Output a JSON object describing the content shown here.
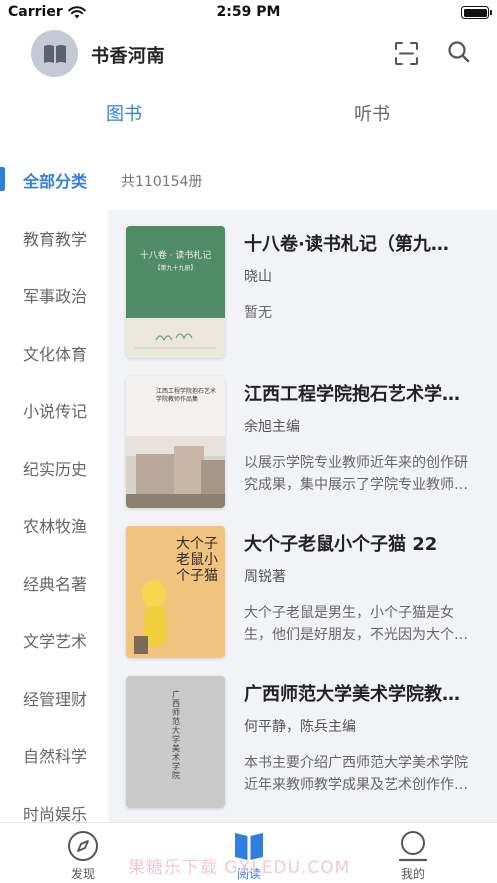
{
  "status_bar": {
    "carrier": "Carrier",
    "time": "2:59 PM"
  },
  "header": {
    "title": "书香河南"
  },
  "tabs": [
    {
      "label": "图书"
    },
    {
      "label": "听书"
    }
  ],
  "sidebar": {
    "items": [
      {
        "label": "全部分类"
      },
      {
        "label": "教育教学"
      },
      {
        "label": "军事政治"
      },
      {
        "label": "文化体育"
      },
      {
        "label": "小说传记"
      },
      {
        "label": "纪实历史"
      },
      {
        "label": "农林牧渔"
      },
      {
        "label": "经典名著"
      },
      {
        "label": "文学艺术"
      },
      {
        "label": "经管理财"
      },
      {
        "label": "自然科学"
      },
      {
        "label": "时尚娱乐"
      }
    ]
  },
  "list": {
    "count": "共110154册",
    "books": [
      {
        "title": "十八卷·读书札记（第九…",
        "author": "晓山",
        "desc": "暂无"
      },
      {
        "title": "江西工程学院抱石艺术学…",
        "author": "余旭主编",
        "desc": "以展示学院专业教师近年来的创作研究成果，集中展示了学院专业教师…"
      },
      {
        "title": "大个子老鼠小个子猫 22",
        "author": "周锐著",
        "desc": "大个子老鼠是男生，小个子猫是女生，他们是好朋友，不光因为大个…"
      },
      {
        "title": "广西师范大学美术学院教…",
        "author": "何平静，陈兵主编",
        "desc": "本书主要介绍广西师范大学美术学院近年来教师教学成果及艺术创作作…"
      }
    ],
    "covers": [
      {
        "text": "十八卷 · 读书札记",
        "sub": "【第九十九册】",
        "bg": "#4f8b64"
      },
      {
        "text": "江西工程学院抱石艺术学院教师作品集",
        "bg": "#efe9e0"
      },
      {
        "text": "大个子老鼠小个子猫",
        "bg": "#f2c37c"
      },
      {
        "text": "广西师范大学美术学院",
        "bg": "#c9c9c9"
      }
    ]
  },
  "tabbar": {
    "items": [
      {
        "label": "发现"
      },
      {
        "label": "阅读"
      },
      {
        "label": "我的"
      }
    ],
    "watermark": "果糖乐下载 GXLEDU.COM"
  },
  "colors": {
    "accent": "#2f7fe0",
    "list_bg": "#f2f3f7",
    "avatar_bg": "#c5c9d6"
  },
  "icons": {
    "wifi": "wifi-icon",
    "battery": "battery-icon",
    "avatar": "open-book-icon",
    "scan": "scan-icon",
    "search": "search-icon",
    "discover": "compass-icon",
    "read": "book-icon",
    "mine": "person-icon"
  }
}
